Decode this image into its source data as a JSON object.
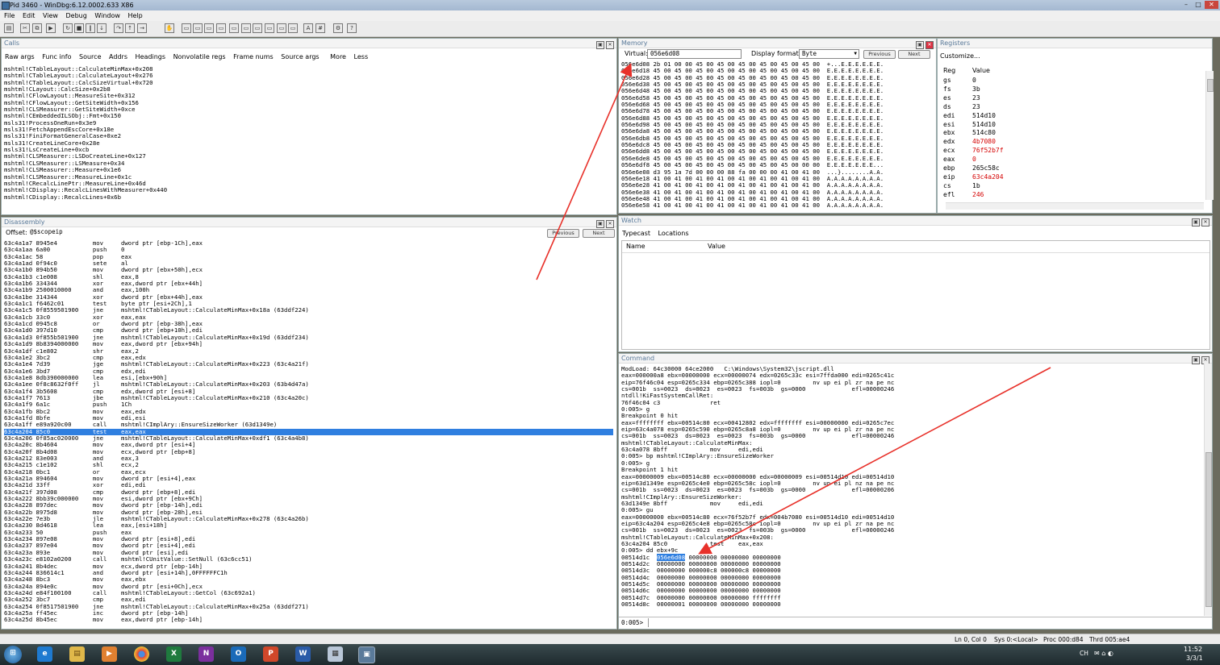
{
  "window": {
    "title": "Pid 3460 - WinDbg:6.12.0002.633 X86"
  },
  "menu": [
    "File",
    "Edit",
    "View",
    "Debug",
    "Window",
    "Help"
  ],
  "calls": {
    "title": "Calls",
    "toolbar": [
      "Raw args",
      "Func info",
      "Source",
      "Addrs",
      "Headings",
      "Nonvolatile regs",
      "Frame nums",
      "Source args",
      "More",
      "Less"
    ],
    "lines": [
      "mshtml!CTableLayout::CalculateMinMax+0x208",
      "mshtml!CTableLayout::CalculateLayout+0x276",
      "mshtml!CTableLayout::CalcSizeVirtual+0x720",
      "mshtml!CLayout::CalcSize+0x2b8",
      "mshtml!CFlowLayout::MeasureSite+0x312",
      "mshtml!CFlowLayout::GetSiteWidth+0x156",
      "mshtml!CLSMeasurer::GetSiteWidth+0xce",
      "mshtml!CEmbeddedILSObj::Fmt+0x150",
      "msls31!ProcessOneRun+0x3e9",
      "msls31!FetchAppendEscCore+0x18e",
      "msls31!FiniFormatGeneralCase+0xe2",
      "msls31!CreateLineCore+0x28e",
      "msls31!LsCreateLine+0xcb",
      "mshtml!CLSMeasurer::LSDoCreateLine+0x127",
      "mshtml!CLSMeasurer::LSMeasure+0x34",
      "mshtml!CLSMeasurer::Measure+0x1e6",
      "mshtml!CLSMeasurer::MeasureLine+0x1c",
      "mshtml!CRecalcLinePtr::MeasureLine+0x46d",
      "mshtml!CDisplay::RecalcLinesWithMeasurer+0x440",
      "mshtml!CDisplay::RecalcLines+0x6b"
    ]
  },
  "memory": {
    "title": "Memory",
    "virtual_label": "Virtual:",
    "virtual_value": "056e6d08",
    "format_label": "Display format:",
    "format_value": "Byte",
    "prev_label": "Previous",
    "next_label": "Next",
    "lines": [
      "056e6d08 2b 01 00 00 45 00 45 00 45 00 45 00 45 00 45 00  +...E.E.E.E.E.E.",
      "056e6d18 45 00 45 00 45 00 45 00 45 00 45 00 45 00 45 00  E.E.E.E.E.E.E.E.",
      "056e6d28 45 00 45 00 45 00 45 00 45 00 45 00 45 00 45 00  E.E.E.E.E.E.E.E.",
      "056e6d38 45 00 45 00 45 00 45 00 45 00 45 00 45 00 45 00  E.E.E.E.E.E.E.E.",
      "056e6d48 45 00 45 00 45 00 45 00 45 00 45 00 45 00 45 00  E.E.E.E.E.E.E.E.",
      "056e6d58 45 00 45 00 45 00 45 00 45 00 45 00 45 00 45 00  E.E.E.E.E.E.E.E.",
      "056e6d68 45 00 45 00 45 00 45 00 45 00 45 00 45 00 45 00  E.E.E.E.E.E.E.E.",
      "056e6d78 45 00 45 00 45 00 45 00 45 00 45 00 45 00 45 00  E.E.E.E.E.E.E.E.",
      "056e6d88 45 00 45 00 45 00 45 00 45 00 45 00 45 00 45 00  E.E.E.E.E.E.E.E.",
      "056e6d98 45 00 45 00 45 00 45 00 45 00 45 00 45 00 45 00  E.E.E.E.E.E.E.E.",
      "056e6da8 45 00 45 00 45 00 45 00 45 00 45 00 45 00 45 00  E.E.E.E.E.E.E.E.",
      "056e6db8 45 00 45 00 45 00 45 00 45 00 45 00 45 00 45 00  E.E.E.E.E.E.E.E.",
      "056e6dc8 45 00 45 00 45 00 45 00 45 00 45 00 45 00 45 00  E.E.E.E.E.E.E.E.",
      "056e6dd8 45 00 45 00 45 00 45 00 45 00 45 00 45 00 45 00  E.E.E.E.E.E.E.E.",
      "056e6de8 45 00 45 00 45 00 45 00 45 00 45 00 45 00 45 00  E.E.E.E.E.E.E.E.",
      "056e6df8 45 00 45 00 45 00 45 00 45 00 45 00 45 00 00 00  E.E.E.E.E.E.E...",
      "056e6e08 d3 95 1a 7d 00 00 00 88 fa 00 00 00 41 00 41 00  ...}........A.A.",
      "056e6e18 41 00 41 00 41 00 41 00 41 00 41 00 41 00 41 00  A.A.A.A.A.A.A.A.",
      "056e6e28 41 00 41 00 41 00 41 00 41 00 41 00 41 00 41 00  A.A.A.A.A.A.A.A.",
      "056e6e38 41 00 41 00 41 00 41 00 41 00 41 00 41 00 41 00  A.A.A.A.A.A.A.A.",
      "056e6e48 41 00 41 00 41 00 41 00 41 00 41 00 41 00 41 00  A.A.A.A.A.A.A.A.",
      "056e6e58 41 00 41 00 41 00 41 00 41 00 41 00 41 00 41 00  A.A.A.A.A.A.A.A."
    ]
  },
  "registers": {
    "title": "Registers",
    "customize": "Customize...",
    "col_reg": "Reg",
    "col_value": "Value",
    "rows": [
      {
        "name": "gs",
        "value": "0",
        "changed": false
      },
      {
        "name": "fs",
        "value": "3b",
        "changed": false
      },
      {
        "name": "es",
        "value": "23",
        "changed": false
      },
      {
        "name": "ds",
        "value": "23",
        "changed": false
      },
      {
        "name": "edi",
        "value": "514d10",
        "changed": false
      },
      {
        "name": "esi",
        "value": "514d10",
        "changed": false
      },
      {
        "name": "ebx",
        "value": "514c80",
        "changed": false
      },
      {
        "name": "edx",
        "value": "4b7080",
        "changed": true
      },
      {
        "name": "ecx",
        "value": "76f52b7f",
        "changed": true
      },
      {
        "name": "eax",
        "value": "0",
        "changed": true
      },
      {
        "name": "ebp",
        "value": "265c58c",
        "changed": false
      },
      {
        "name": "eip",
        "value": "63c4a204",
        "changed": true
      },
      {
        "name": "cs",
        "value": "1b",
        "changed": false
      },
      {
        "name": "efl",
        "value": "246",
        "changed": true
      }
    ],
    "changed_color": "#d40000"
  },
  "disassembly": {
    "title": "Disassembly",
    "offset_label": "Offset:",
    "offset_value": "@$scopeip",
    "prev_label": "Previous",
    "next_label": "Next",
    "selected_index": 30,
    "lines": [
      "63c4a1a7 8945e4          mov     dword ptr [ebp-1Ch],eax",
      "63c4a1aa 6a00            push    0",
      "63c4a1ac 58              pop     eax",
      "63c4a1ad 0f94c0          sete    al",
      "63c4a1b0 894b50          mov     dword ptr [ebx+50h],ecx",
      "63c4a1b3 c1e008          shl     eax,8",
      "63c4a1b6 334344          xor     eax,dword ptr [ebx+44h]",
      "63c4a1b9 2500010000      and     eax,100h",
      "63c4a1be 314344          xor     dword ptr [ebx+44h],eax",
      "63c4a1c1 f6462c01        test    byte ptr [esi+2Ch],1",
      "63c4a1c5 0f8559501900    jne     mshtml!CTableLayout::CalculateMinMax+0x18a (63ddf224)",
      "63c4a1cb 33c0            xor     eax,eax",
      "63c4a1cd 0945c8          or      dword ptr [ebp-38h],eax",
      "63c4a1d0 397d10          cmp     dword ptr [ebp+10h],edi",
      "63c4a1d3 0f855b501900    jne     mshtml!CTableLayout::CalculateMinMax+0x19d (63ddf234)",
      "63c4a1d9 8b8394000000    mov     eax,dword ptr [ebx+94h]",
      "63c4a1df c1e802          shr     eax,2",
      "63c4a1e2 3bc2            cmp     eax,edx",
      "63c4a1e4 7d39            jge     mshtml!CTableLayout::CalculateMinMax+0x223 (63c4a21f)",
      "63c4a1e6 3bd7            cmp     edx,edi",
      "63c4a1e8 8db390000000    lea     esi,[ebx+90h]",
      "63c4a1ee 0f8c8632f0ff    jl      mshtml!CTableLayout::CalculateMinMax+0x203 (63b4d47a)",
      "63c4a1f4 3b5608          cmp     edx,dword ptr [esi+8]",
      "63c4a1f7 7613            jbe     mshtml!CTableLayout::CalculateMinMax+0x210 (63c4a20c)",
      "63c4a1f9 6a1c            push    1Ch",
      "63c4a1fb 8bc2            mov     eax,edx",
      "63c4a1fd 8bfe            mov     edi,esi",
      "63c4a1ff e89a920c00      call    mshtml!CImplAry::EnsureSizeWorker (63d1349e)",
      "63c4a204 85c0            test    eax,eax",
      "63c4a206 0f85ac020000    jne     mshtml!CTableLayout::CalculateMinMax+0xdf1 (63c4a4b8)",
      "63c4a20c 8b4604          mov     eax,dword ptr [esi+4]",
      "63c4a20f 8b4d08          mov     ecx,dword ptr [ebp+8]",
      "63c4a212 83e003          and     eax,3",
      "63c4a215 c1e102          shl     ecx,2",
      "63c4a218 0bc1            or      eax,ecx",
      "63c4a21a 894604          mov     dword ptr [esi+4],eax",
      "63c4a21d 33ff            xor     edi,edi",
      "63c4a21f 397d08          cmp     dword ptr [ebp+8],edi",
      "63c4a222 8bb39c000000    mov     esi,dword ptr [ebx+9Ch]",
      "63c4a228 897dec          mov     dword ptr [ebp-14h],edi",
      "63c4a22b 8975d8          mov     dword ptr [ebp-28h],esi",
      "63c4a22e 7e3b            jle     mshtml!CTableLayout::CalculateMinMax+0x278 (63c4a26b)",
      "63c4a230 8d4618          lea     eax,[esi+18h]",
      "63c4a233 50              push    eax",
      "63c4a234 897e08          mov     dword ptr [esi+8],edi",
      "63c4a237 897e04          mov     dword ptr [esi+4],edi",
      "63c4a23a 893e            mov     dword ptr [esi],edi",
      "63c4a23c e8102a0200      call    mshtml!CUnitValue::SetNull (63c6cc51)",
      "63c4a241 8b4dec          mov     ecx,dword ptr [ebp-14h]",
      "63c4a244 836614c1        and     dword ptr [esi+14h],0FFFFFFC1h",
      "63c4a248 8bc3            mov     eax,ebx",
      "63c4a24a 894e0c          mov     dword ptr [esi+0Ch],ecx",
      "63c4a24d e84f100100      call    mshtml!CTableLayout::GetCol (63c692a1)",
      "63c4a252 3bc7            cmp     eax,edi",
      "63c4a254 0f8517501900    jne     mshtml!CTableLayout::CalculateMinMax+0x25a (63ddf271)",
      "63c4a25a ff45ec          inc     dword ptr [ebp-14h]",
      "63c4a25d 8b45ec          mov     eax,dword ptr [ebp-14h]"
    ]
  },
  "watch": {
    "title": "Watch",
    "toolbar": [
      "Typecast",
      "Locations"
    ],
    "col_name": "Name",
    "col_value": "Value"
  },
  "command": {
    "title": "Command",
    "prompt": "0:005>",
    "highlight_text": "056e6d08",
    "lines": [
      "ModLoad: 64c30000 64ce2000   C:\\Windows\\System32\\jscript.dll",
      "eax=000000a8 ebx=00000000 ecx=00000074 edx=0265c33c esi=7ffda000 edi=0265c41c",
      "eip=76f46c04 esp=0265c334 ebp=0265c388 iopl=0         nv up ei pl zr na pe nc",
      "cs=001b  ss=0023  ds=0023  es=0023  fs=003b  gs=0000             efl=00000246",
      "ntdll!KiFastSystemCallRet:",
      "76f46c04 c3              ret",
      "0:005> g",
      "Breakpoint 0 hit",
      "eax=ffffffff ebx=00514c80 ecx=00412802 edx=ffffffff esi=00000000 edi=0265c7ec",
      "eip=63c4a078 esp=0265c590 ebp=0265c8a8 iopl=0         nv up ei pl zr na pe nc",
      "cs=001b  ss=0023  ds=0023  es=0023  fs=003b  gs=0000             efl=00000246",
      "mshtml!CTableLayout::CalculateMinMax:",
      "63c4a078 8bff            mov     edi,edi",
      "0:005> bp mshtml!CImplAry::EnsureSizeWorker",
      "0:005> g",
      "Breakpoint 1 hit",
      "eax=00000009 ebx=00514c80 ecx=00000000 edx=00000009 esi=00514d10 edi=00514d10",
      "eip=63d1349e esp=0265c4e0 ebp=0265c58c iopl=0         nv up ei pl nz na pe nc",
      "cs=001b  ss=0023  ds=0023  es=0023  fs=003b  gs=0000             efl=00000206",
      "mshtml!CImplAry::EnsureSizeWorker:",
      "63d1349e 8bff            mov     edi,edi",
      "0:005> gu",
      "eax=00000000 ebx=00514c80 ecx=76f52b7f edx=004b7080 esi=00514d10 edi=00514d10",
      "eip=63c4a204 esp=0265c4e8 ebp=0265c58c iopl=0         nv up ei pl zr na pe nc",
      "cs=001b  ss=0023  ds=0023  es=0023  fs=003b  gs=0000             efl=00000246",
      "mshtml!CTableLayout::CalculateMinMax+0x208:",
      "63c4a204 85c0            test    eax,eax",
      "0:005> dd ebx+9c",
      "00514d1c  056e6d08 00000000 00000000 00000000",
      "00514d2c  00000000 00000000 00000000 00000000",
      "00514d3c  00000000 000000c8 000000c8 00000000",
      "00514d4c  00000000 00000000 00000000 00000000",
      "00514d5c  00000000 00000000 00000000 00000000",
      "00514d6c  00000000 00000000 00000000 00000000",
      "00514d7c  00000000 00000000 00000000 ffffffff",
      "00514d8c  00000001 00000000 00000000 00000000"
    ]
  },
  "status": {
    "ln_col": "Ln 0, Col 0",
    "sys": "Sys 0:<Local>",
    "proc": "Proc 000:d84",
    "thrd": "Thrd 005:ae4"
  },
  "taskbar": {
    "time": "11:52",
    "date": "3/3/1",
    "lang": "CH",
    "apps": [
      "start-icon",
      "ie-icon",
      "explorer-icon",
      "media-icon",
      "chrome-icon",
      "excel-icon",
      "onenote-icon",
      "outlook-icon",
      "powerpoint-icon",
      "word-icon",
      "notepad-icon",
      "windbg-icon"
    ]
  },
  "colors": {
    "arrow": "#e8312a",
    "selection": "#2f7fe0",
    "pane_title": "#5a7a9a"
  }
}
